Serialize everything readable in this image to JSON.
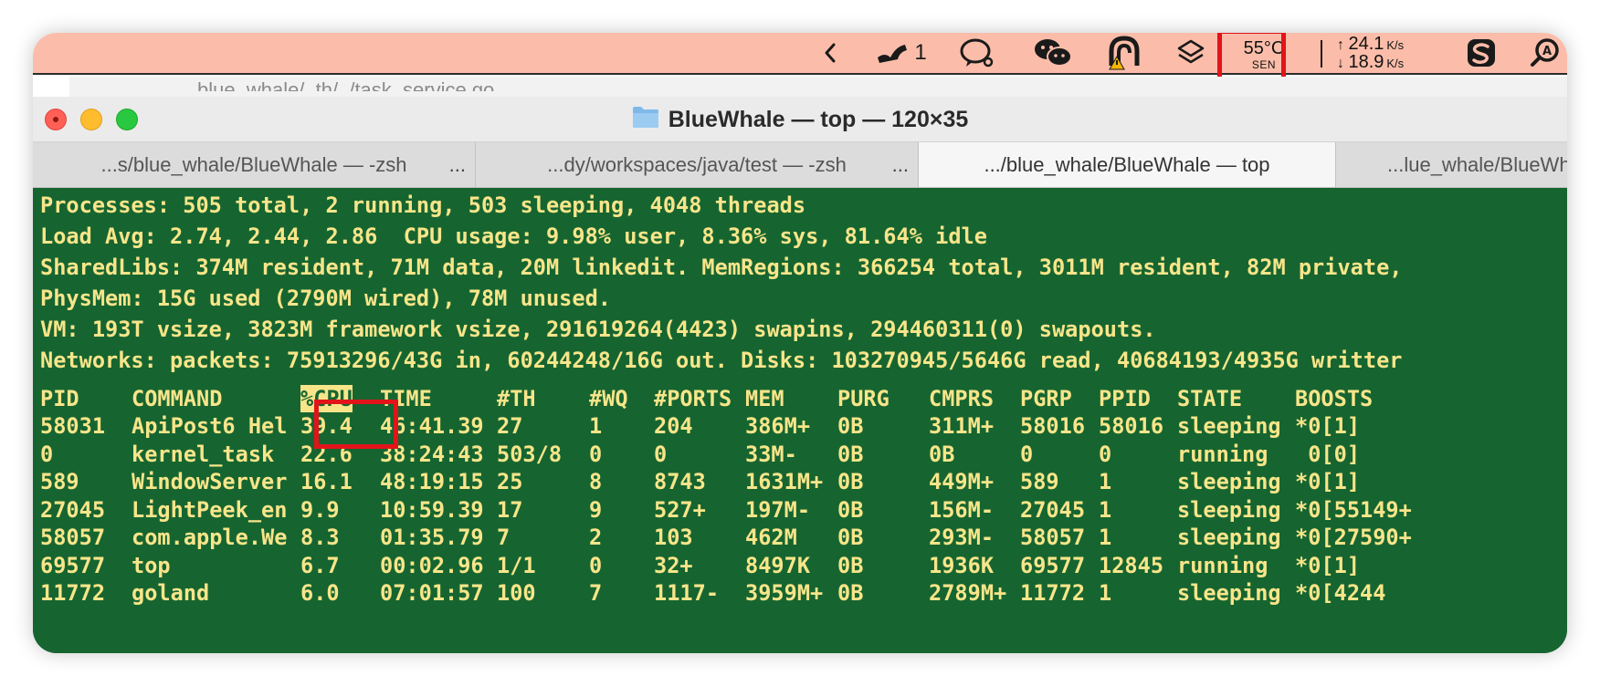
{
  "menubar": {
    "icons": [
      "chevron-left-icon",
      "notification-bell-icon",
      "chat-bubble-icon",
      "wechat-icon",
      "vpn-warning-icon",
      "layers-icon",
      "s-app-icon",
      "search-a-icon"
    ],
    "notification_count": "1",
    "temperature": {
      "value": "55°C",
      "label": "SEN"
    },
    "network": {
      "up": "24.1",
      "down": "18.9",
      "unit": "K/s"
    },
    "highlight_color": "#e1141a"
  },
  "window": {
    "title": "BlueWhale — top — 120×35",
    "background_title": "blue_whale/..th/../task_service.go",
    "tabs": [
      {
        "label": "...s/blue_whale/BlueWhale — -zsh"
      },
      {
        "label": "...dy/workspaces/java/test — -zsh"
      },
      {
        "label": ".../blue_whale/BlueWhale — top"
      },
      {
        "label": "...lue_whale/BlueWhale"
      }
    ],
    "tab_more": "..."
  },
  "terminal": {
    "colors": {
      "background": "#166530",
      "text": "#f8e58a"
    },
    "summary": [
      "Processes: 505 total, 2 running, 503 sleeping, 4048 threads",
      "Load Avg: 2.74, 2.44, 2.86  CPU usage: 9.98% user, 8.36% sys, 81.64% idle",
      "SharedLibs: 374M resident, 71M data, 20M linkedit. MemRegions: 366254 total, 3011M resident, 82M private,",
      "PhysMem: 15G used (2790M wired), 78M unused.",
      "VM: 193T vsize, 3823M framework vsize, 291619264(4423) swapins, 294460311(0) swapouts.",
      "Networks: packets: 75913296/43G in, 60244248/16G out. Disks: 103270945/5646G read, 40684193/4935G writter"
    ],
    "columns": [
      "PID",
      "COMMAND",
      "%CPU",
      "TIME",
      "#TH",
      "#WQ",
      "#PORTS",
      "MEM",
      "PURG",
      "CMPRS",
      "PGRP",
      "PPID",
      "STATE",
      "BOOSTS"
    ],
    "rows": [
      [
        "58031",
        "ApiPost6 Hel",
        "39.4",
        "46:41.39",
        "27",
        "1",
        "204",
        "386M+",
        "0B",
        "311M+",
        "58016",
        "58016",
        "sleeping",
        "*0[1]"
      ],
      [
        "0",
        "kernel_task",
        "22.6",
        "38:24:43",
        "503/8",
        "0",
        "0",
        "33M-",
        "0B",
        "0B",
        "0",
        "0",
        "running",
        " 0[0]"
      ],
      [
        "589",
        "WindowServer",
        "16.1",
        "48:19:15",
        "25",
        "8",
        "8743",
        "1631M+",
        "0B",
        "449M+",
        "589",
        "1",
        "sleeping",
        "*0[1]"
      ],
      [
        "27045",
        "LightPeek_en",
        "9.9",
        "10:59.39",
        "17",
        "9",
        "527+",
        "197M-",
        "0B",
        "156M-",
        "27045",
        "1",
        "sleeping",
        "*0[55149+"
      ],
      [
        "58057",
        "com.apple.We",
        "8.3",
        "01:35.79",
        "7",
        "2",
        "103",
        "462M",
        "0B",
        "293M-",
        "58057",
        "1",
        "sleeping",
        "*0[27590+"
      ],
      [
        "69577",
        "top",
        "6.7",
        "00:02.96",
        "1/1",
        "0",
        "32+",
        "8497K",
        "0B",
        "1936K",
        "69577",
        "12845",
        "running",
        "*0[1]"
      ],
      [
        "11772",
        "goland",
        "6.0",
        "07:01:57",
        "100",
        "7",
        "1117-",
        "3959M+",
        "0B",
        "2789M+",
        "11772",
        "1",
        "sleeping",
        "*0[4244"
      ]
    ]
  }
}
